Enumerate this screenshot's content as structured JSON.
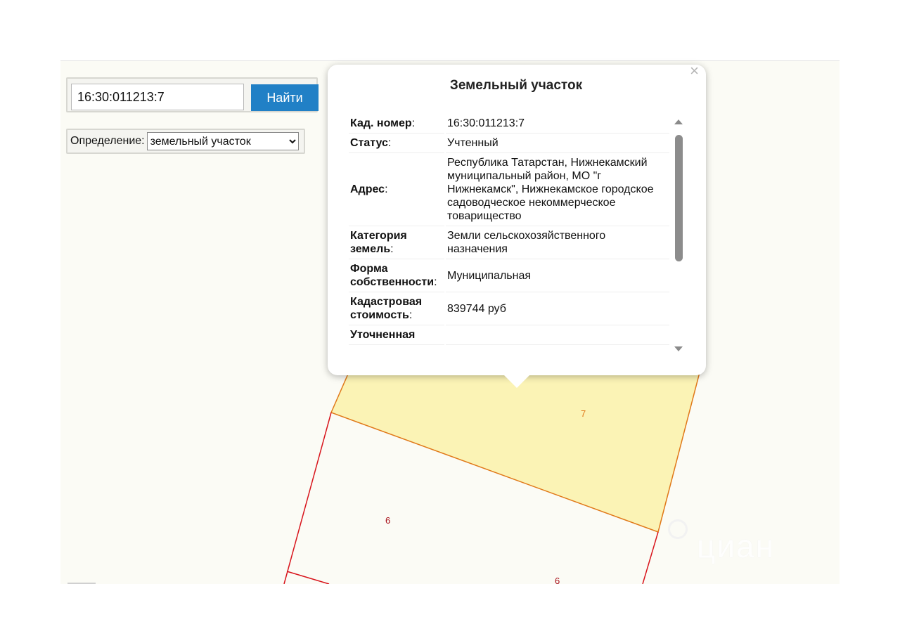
{
  "search": {
    "value": "16:30:011213:7",
    "button_label": "Найти"
  },
  "definition": {
    "label": "Определение:",
    "selected": "земельный участок"
  },
  "map": {
    "parcels": [
      {
        "label": "7"
      },
      {
        "label": "6"
      },
      {
        "label": "6"
      }
    ],
    "watermark": "циан"
  },
  "popup": {
    "close_label": "×",
    "title": "Земельный участок",
    "rows": [
      {
        "key": "Кад. номер",
        "value": "16:30:011213:7"
      },
      {
        "key": "Статус",
        "value": "Учтенный"
      },
      {
        "key": "Адрес",
        "value": "Республика Татарстан, Нижнекамский муниципальный район, МО \"г Нижнекамск\", Нижнекамское городское садоводческое некоммерческое товарищество"
      },
      {
        "key": "Категория земель",
        "value": "Земли сельскохозяйственного назначения"
      },
      {
        "key": "Форма собственности",
        "value": "Муниципальная"
      },
      {
        "key": "Кадастровая стоимость",
        "value": "839744 руб"
      },
      {
        "key": "Уточненная",
        "value": ""
      }
    ]
  },
  "colors": {
    "accent": "#2180c6",
    "parcel_fill": "#fbf3b5",
    "parcel_border": "#e07818",
    "boundary": "#d8141c"
  }
}
